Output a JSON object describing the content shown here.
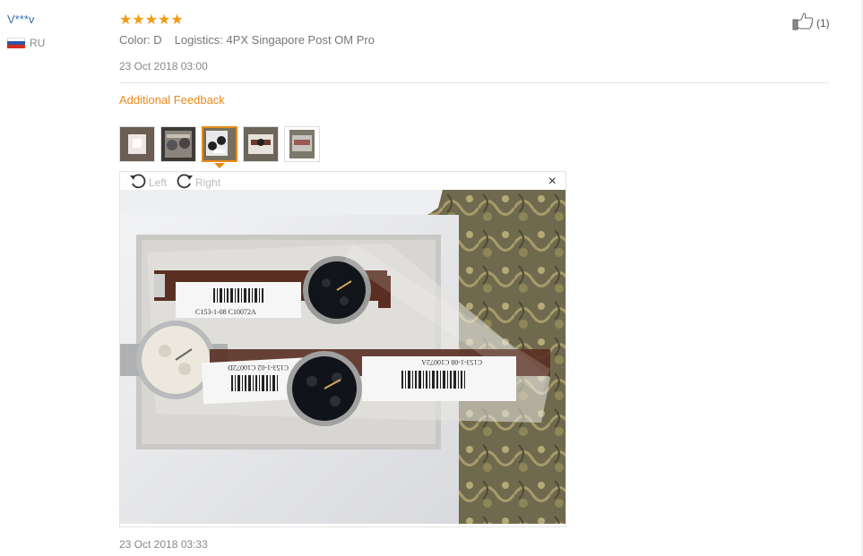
{
  "review": {
    "user": "V***v",
    "country": "RU",
    "rating": "★★★★★",
    "color": "Color: D",
    "logistics": "Logistics: 4PX Singapore Post OM Pro",
    "date": "23 Oct 2018 03:00",
    "like_count": "(1)",
    "additional_feedback_label": "Additional Feedback",
    "additional_feedback_date": "23 Oct 2018 03:33"
  },
  "viewer": {
    "rotate_left_label": "Left",
    "rotate_right_label": "Right",
    "close_label": "×",
    "selected_thumb_index": 2
  },
  "thumbnails": [
    {
      "name": "photo-1"
    },
    {
      "name": "photo-2"
    },
    {
      "name": "photo-3"
    },
    {
      "name": "photo-4"
    },
    {
      "name": "photo-5"
    }
  ],
  "photo_labels": {
    "top_sticker": "C153-1-08 C10072A",
    "right_sticker": "C153-1-08 C10072A",
    "left_sticker": "C153-1-02 C10072D"
  },
  "colors": {
    "accent": "#e88a1a",
    "link": "#3a6fb5",
    "star": "#f39c12"
  }
}
